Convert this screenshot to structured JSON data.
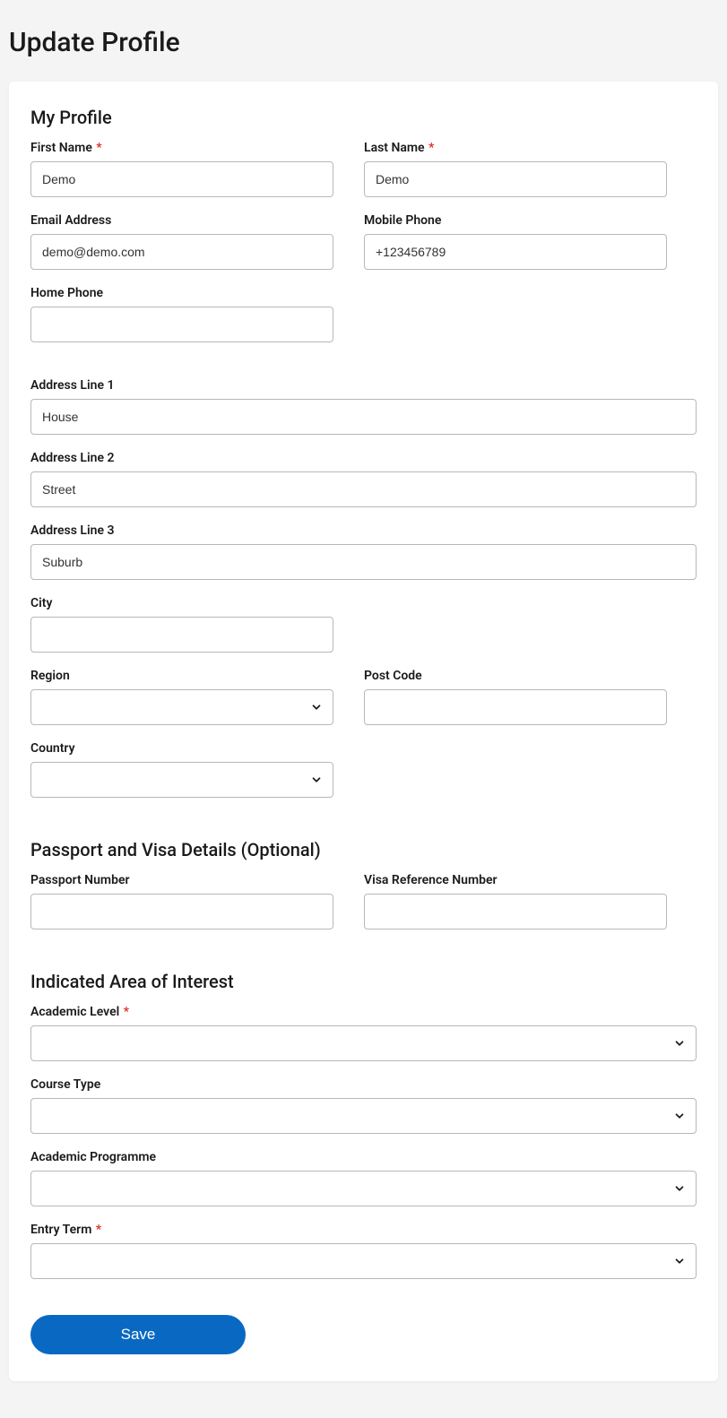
{
  "page": {
    "title": "Update Profile"
  },
  "sections": {
    "myProfile": {
      "heading": "My Profile"
    },
    "passportVisa": {
      "heading": "Passport and Visa Details (Optional)"
    },
    "areaOfInterest": {
      "heading": "Indicated Area of Interest"
    }
  },
  "labels": {
    "firstName": "First Name",
    "lastName": "Last Name",
    "email": "Email Address",
    "mobilePhone": "Mobile Phone",
    "homePhone": "Home Phone",
    "addressLine1": "Address Line 1",
    "addressLine2": "Address Line 2",
    "addressLine3": "Address Line 3",
    "city": "City",
    "region": "Region",
    "postCode": "Post Code",
    "country": "Country",
    "passportNumber": "Passport Number",
    "visaReference": "Visa Reference Number",
    "academicLevel": "Academic Level",
    "courseType": "Course Type",
    "academicProgramme": "Academic Programme",
    "entryTerm": "Entry Term"
  },
  "values": {
    "firstName": "Demo",
    "lastName": "Demo",
    "email": "demo@demo.com",
    "mobilePhone": "+123456789",
    "homePhone": "",
    "addressLine1": "House",
    "addressLine2": "Street",
    "addressLine3": "Suburb",
    "city": "",
    "region": "",
    "postCode": "",
    "country": "",
    "passportNumber": "",
    "visaReference": "",
    "academicLevel": "",
    "courseType": "",
    "academicProgramme": "",
    "entryTerm": ""
  },
  "buttons": {
    "save": "Save"
  },
  "requiredMark": "*"
}
